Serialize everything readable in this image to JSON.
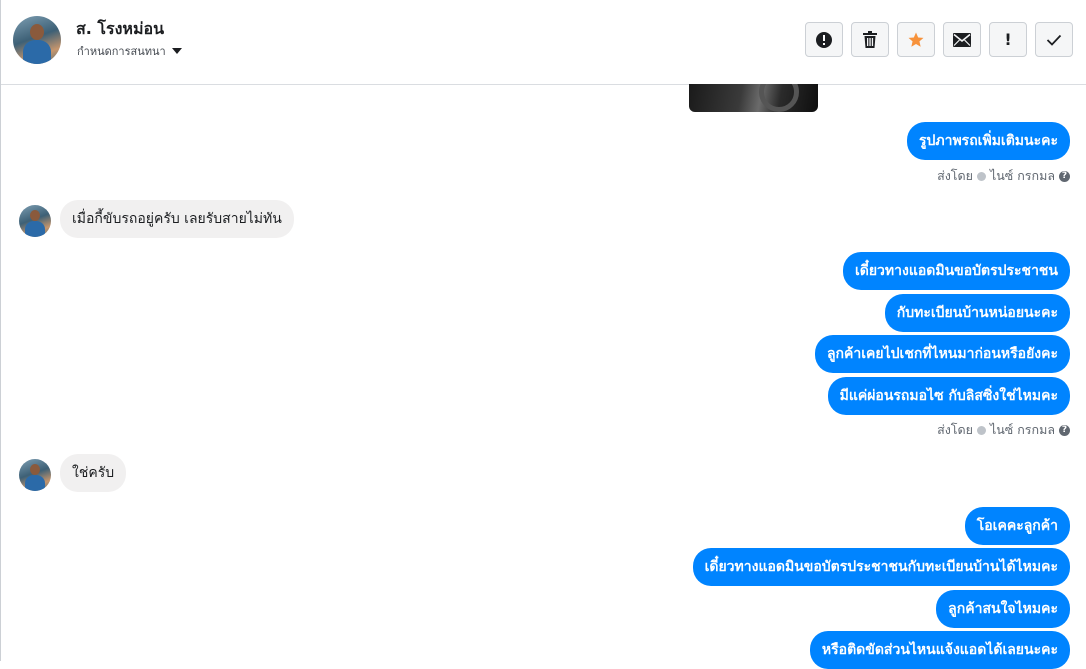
{
  "header": {
    "contact_name": "ส. โรงหม่อน",
    "conversation_setting": "กำหนดการสนทนา",
    "toolbar": [
      "spam-icon",
      "trash-icon",
      "star-icon",
      "mail-icon",
      "important-icon",
      "check-icon"
    ],
    "important_glyph": "!"
  },
  "colors": {
    "outgoing_bubble": "#0084ff",
    "incoming_bubble": "#f1f0f0",
    "star": "#f7923b"
  },
  "messages": {
    "out1": "รูปภาพรถเพิ่มเติมนะคะ",
    "sent_by_1": {
      "prefix": "ส่งโดย",
      "name": "ไนซ์ กรกมล",
      "help": "?"
    },
    "in1": "เมื่อกี้ขับรถอยู่ครับ เลยรับสายไม่ทัน",
    "out2": "เดี๋ยวทางแอดมินขอบัตรประชาชน",
    "out3": "กับทะเบียนบ้านหน่อยนะคะ",
    "out4": "ลูกค้าเคยไปเชกที่ไหนมาก่อนหรือยังคะ",
    "out5": "มีแค่ผ่อนรถมอไซ กับลิสซิ่งใช่ไหมคะ",
    "sent_by_2": {
      "prefix": "ส่งโดย",
      "name": "ไนซ์ กรกมล",
      "help": "?"
    },
    "in2": "ใช่ครับ",
    "out6": "โอเคคะลูกค้า",
    "out7": "เดี๋ยวทางแอดมินขอบัตรประชาชนกับทะเบียนบ้านได้ไหมคะ",
    "out8": "ลูกค้าสนใจไหมคะ",
    "out9": "หรือติดขัดส่วนไหนแจ้งแอดได้เลยนะคะ"
  }
}
